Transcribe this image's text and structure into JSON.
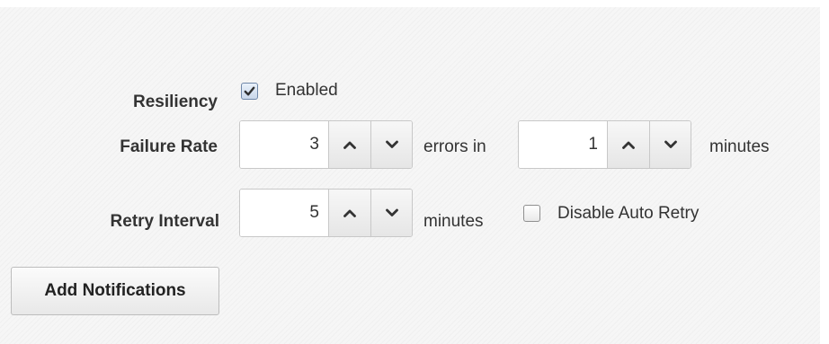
{
  "resiliency": {
    "label": "Resiliency",
    "checkbox_label": "Enabled",
    "checked": true
  },
  "failure_rate": {
    "label": "Failure Rate",
    "errors_value": "3",
    "errors_suffix": "errors in",
    "minutes_value": "1",
    "minutes_suffix": "minutes"
  },
  "retry_interval": {
    "label": "Retry Interval",
    "value": "5",
    "suffix": "minutes",
    "disable_label": "Disable Auto Retry",
    "disable_checked": false
  },
  "add_notifications": {
    "label": "Add Notifications"
  },
  "icons": {
    "increment": "chevron-up-icon",
    "decrement": "chevron-down-icon",
    "check": "checkmark-icon"
  },
  "colors": {
    "panel_background": "#f6f6f6",
    "text": "#333333",
    "border": "#c8c8c8"
  }
}
